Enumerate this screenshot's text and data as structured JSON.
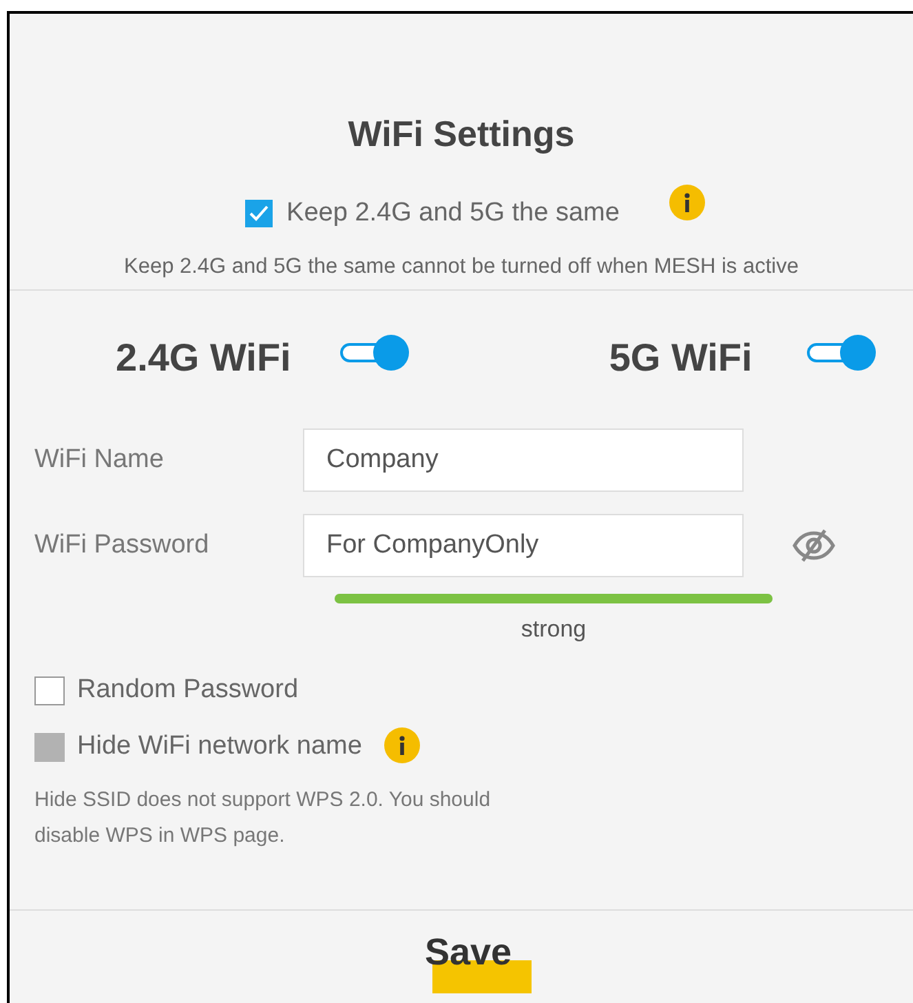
{
  "title": "WiFi Settings",
  "keep_same": {
    "label": "Keep 2.4G and 5G the same",
    "checked": true
  },
  "mesh_note": "Keep 2.4G and 5G the same cannot be turned off when MESH is active",
  "bands": [
    {
      "label": "2.4G WiFi",
      "on": true
    },
    {
      "label": "5G WiFi",
      "on": true
    }
  ],
  "fields": [
    {
      "label": "WiFi Name",
      "value": "Company",
      "kind": "text"
    },
    {
      "label": "WiFi Password",
      "value": "For CompanyOnly",
      "kind": "password"
    }
  ],
  "strength": {
    "level": 1,
    "label": "strong"
  },
  "options": [
    {
      "label": "Random Password",
      "checked": false,
      "disabled": false,
      "info": false
    },
    {
      "label": "Hide WiFi network name",
      "checked": false,
      "disabled": true,
      "info": true
    }
  ],
  "hide_note": "Hide SSID does not support WPS 2.0. You should disable WPS in WPS page.",
  "save": "Save"
}
